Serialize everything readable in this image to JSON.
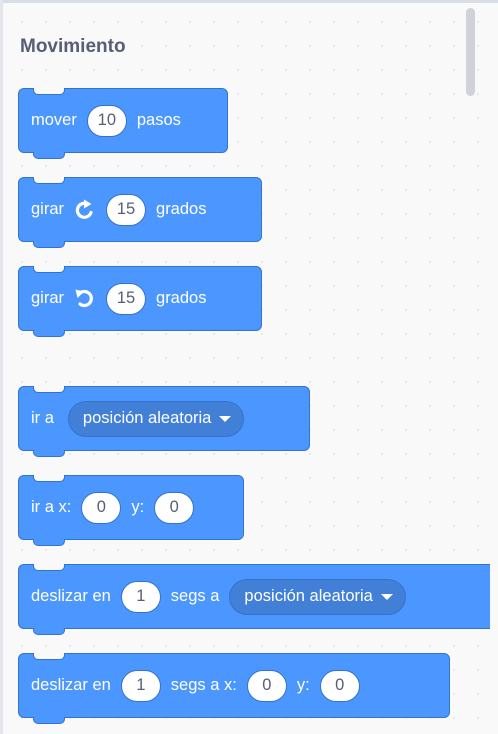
{
  "category": {
    "title": "Movimiento"
  },
  "blocks": {
    "move": {
      "prefix": "mover",
      "steps": "10",
      "suffix": "pasos"
    },
    "turn_right": {
      "prefix": "girar",
      "icon": "rotate-clockwise-icon",
      "degrees": "15",
      "suffix": "grados"
    },
    "turn_left": {
      "prefix": "girar",
      "icon": "rotate-counterclockwise-icon",
      "degrees": "15",
      "suffix": "grados"
    },
    "goto_menu": {
      "prefix": "ir a",
      "option": "posición aleatoria"
    },
    "goto_xy": {
      "prefix": "ir a x:",
      "x": "0",
      "ylabel": "y:",
      "y": "0"
    },
    "glide_menu": {
      "prefix": "deslizar en",
      "secs": "1",
      "middle": "segs a",
      "option": "posición aleatoria"
    },
    "glide_xy": {
      "prefix": "deslizar en",
      "secs": "1",
      "middle": "segs a x:",
      "x": "0",
      "ylabel": "y:",
      "y": "0"
    }
  },
  "colors": {
    "motion": "#4c97ff",
    "motion_border": "#3373cc",
    "motion_menu": "#4280d7",
    "title": "#575e75"
  }
}
